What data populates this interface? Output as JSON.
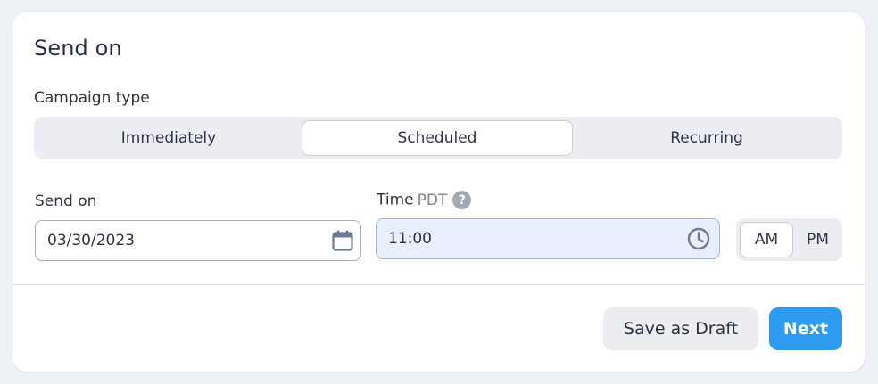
{
  "section": {
    "title": "Send on",
    "campaign_type_label": "Campaign type",
    "campaign_type_options": [
      "Immediately",
      "Scheduled",
      "Recurring"
    ],
    "selected_campaign_type": "Scheduled"
  },
  "schedule": {
    "date_label": "Send on",
    "date_value": "03/30/2023",
    "time_label": "Time",
    "timezone": "PDT",
    "help_glyph": "?",
    "time_value": "11:00",
    "meridiem_options": [
      "AM",
      "PM"
    ],
    "selected_meridiem": "AM"
  },
  "actions": {
    "save_draft_label": "Save as Draft",
    "next_label": "Next"
  },
  "icons": {
    "date": "calendar-icon",
    "time": "clock-icon",
    "help": "help-icon"
  },
  "colors": {
    "accent": "#2d9cf0",
    "time_field_bg": "#e7effc",
    "segment_bg": "#ebedf1"
  }
}
